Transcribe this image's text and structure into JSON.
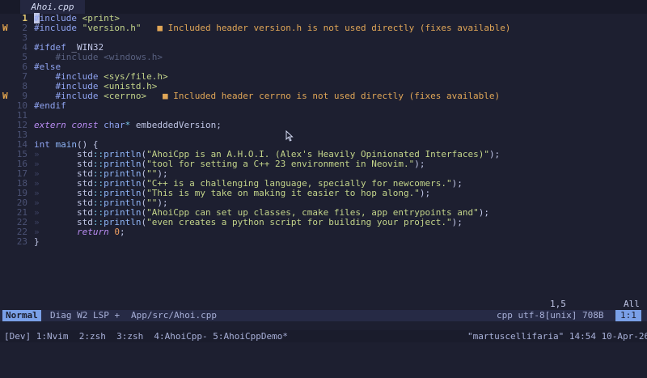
{
  "tab": {
    "label": "Ahoi.cpp"
  },
  "lines": [
    {
      "n": "1",
      "sign": "",
      "current": true,
      "tokens": [
        [
          "pp",
          "#"
        ],
        [
          "pp",
          "include "
        ],
        [
          "inc",
          "<print>"
        ]
      ]
    },
    {
      "n": "2",
      "sign": "W",
      "tokens": [
        [
          "pp",
          "#include "
        ],
        [
          "inc",
          "\"version.h\""
        ]
      ],
      "diag": "■ Included header version.h is not used directly (fixes available)"
    },
    {
      "n": "3",
      "sign": "",
      "tokens": []
    },
    {
      "n": "4",
      "sign": "",
      "tokens": [
        [
          "pp",
          "#ifdef "
        ],
        [
          "ns",
          "_WIN32"
        ]
      ]
    },
    {
      "n": "5",
      "sign": "",
      "tokens": [
        [
          "dim",
          "    #include <windows.h>"
        ]
      ]
    },
    {
      "n": "6",
      "sign": "",
      "tokens": [
        [
          "pp",
          "#else"
        ]
      ]
    },
    {
      "n": "7",
      "sign": "",
      "tokens": [
        [
          "pp",
          "    #include "
        ],
        [
          "inc",
          "<sys/file.h>"
        ]
      ]
    },
    {
      "n": "8",
      "sign": "",
      "tokens": [
        [
          "pp",
          "    #include "
        ],
        [
          "inc",
          "<unistd.h>"
        ]
      ]
    },
    {
      "n": "9",
      "sign": "W",
      "tokens": [
        [
          "pp",
          "    #include "
        ],
        [
          "inc",
          "<cerrno>"
        ]
      ],
      "diag": "■ Included header cerrno is not used directly (fixes available)"
    },
    {
      "n": "10",
      "sign": "",
      "tokens": [
        [
          "pp",
          "#endif"
        ]
      ]
    },
    {
      "n": "11",
      "sign": "",
      "tokens": []
    },
    {
      "n": "12",
      "sign": "",
      "tokens": [
        [
          "kwi",
          "extern "
        ],
        [
          "kwi",
          "const "
        ],
        [
          "ty",
          "char"
        ],
        [
          "op",
          "* "
        ],
        [
          "ns",
          "embeddedVersion;"
        ]
      ]
    },
    {
      "n": "13",
      "sign": "",
      "tokens": []
    },
    {
      "n": "14",
      "sign": "",
      "tokens": [
        [
          "ty",
          "int "
        ],
        [
          "fn",
          "main"
        ],
        [
          "ns",
          "() {"
        ]
      ]
    },
    {
      "n": "15",
      "sign": "",
      "tokens": [
        [
          "guide",
          "»       "
        ],
        [
          "ns",
          "std"
        ],
        [
          "op",
          "::"
        ],
        [
          "fn",
          "println"
        ],
        [
          "ns",
          "("
        ],
        [
          "str",
          "\"AhoiCpp is an A.H.O.I. (Alex's Heavily Opinionated Interfaces)\""
        ],
        [
          "ns",
          ");"
        ]
      ]
    },
    {
      "n": "16",
      "sign": "",
      "tokens": [
        [
          "guide",
          "»       "
        ],
        [
          "ns",
          "std"
        ],
        [
          "op",
          "::"
        ],
        [
          "fn",
          "println"
        ],
        [
          "ns",
          "("
        ],
        [
          "str",
          "\"tool for setting a C++ 23 environment in Neovim.\""
        ],
        [
          "ns",
          ");"
        ]
      ]
    },
    {
      "n": "17",
      "sign": "",
      "tokens": [
        [
          "guide",
          "»       "
        ],
        [
          "ns",
          "std"
        ],
        [
          "op",
          "::"
        ],
        [
          "fn",
          "println"
        ],
        [
          "ns",
          "("
        ],
        [
          "str",
          "\"\""
        ],
        [
          "ns",
          ");"
        ]
      ]
    },
    {
      "n": "18",
      "sign": "",
      "tokens": [
        [
          "guide",
          "»       "
        ],
        [
          "ns",
          "std"
        ],
        [
          "op",
          "::"
        ],
        [
          "fn",
          "println"
        ],
        [
          "ns",
          "("
        ],
        [
          "str",
          "\"C++ is a challenging language, specially for newcomers.\""
        ],
        [
          "ns",
          ");"
        ]
      ]
    },
    {
      "n": "19",
      "sign": "",
      "tokens": [
        [
          "guide",
          "»       "
        ],
        [
          "ns",
          "std"
        ],
        [
          "op",
          "::"
        ],
        [
          "fn",
          "println"
        ],
        [
          "ns",
          "("
        ],
        [
          "str",
          "\"This is my take on making it easier to hop along.\""
        ],
        [
          "ns",
          ");"
        ]
      ]
    },
    {
      "n": "20",
      "sign": "",
      "tokens": [
        [
          "guide",
          "»       "
        ],
        [
          "ns",
          "std"
        ],
        [
          "op",
          "::"
        ],
        [
          "fn",
          "println"
        ],
        [
          "ns",
          "("
        ],
        [
          "str",
          "\"\""
        ],
        [
          "ns",
          ");"
        ]
      ]
    },
    {
      "n": "21",
      "sign": "",
      "tokens": [
        [
          "guide",
          "»       "
        ],
        [
          "ns",
          "std"
        ],
        [
          "op",
          "::"
        ],
        [
          "fn",
          "println"
        ],
        [
          "ns",
          "("
        ],
        [
          "str",
          "\"AhoiCpp can set up classes, cmake files, app entrypoints and\""
        ],
        [
          "ns",
          ");"
        ]
      ]
    },
    {
      "n": "22",
      "sign": "",
      "tokens": [
        [
          "guide",
          "»       "
        ],
        [
          "ns",
          "std"
        ],
        [
          "op",
          "::"
        ],
        [
          "fn",
          "println"
        ],
        [
          "ns",
          "("
        ],
        [
          "str",
          "\"even creates a python script for building your project.\""
        ],
        [
          "ns",
          ");"
        ]
      ]
    },
    {
      "n": "22",
      "sign": "",
      "tokens": [
        [
          "guide",
          "»       "
        ],
        [
          "kwi",
          "return "
        ],
        [
          "num",
          "0"
        ],
        [
          "ns",
          ";"
        ]
      ]
    },
    {
      "n": "23",
      "sign": "",
      "tokens": [
        [
          "ns",
          "}"
        ]
      ]
    }
  ],
  "ruler": {
    "pos": "1,5",
    "scroll": "All"
  },
  "statusline": {
    "mode": "Normal",
    "info": "Diag W2 LSP +",
    "path": "App/src/Ahoi.cpp",
    "right": "cpp utf-8[unix] 708B",
    "location": "1:1"
  },
  "tmux": {
    "left": "[Dev] 1:Nvim  2:zsh  3:zsh  4:AhoiCpp- 5:AhoiCppDemo*",
    "right": "\"martuscellifaria\" 14:54 10-Apr-26"
  }
}
